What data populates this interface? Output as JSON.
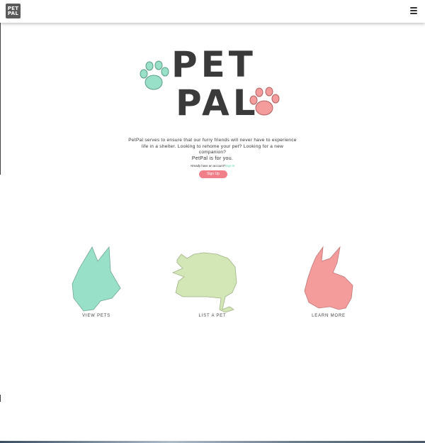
{
  "navbar": {
    "logo_line1": "PET",
    "logo_line2": "PAL",
    "menu_icon": "hamburger-menu-icon"
  },
  "hero": {
    "logo_word1": "PET",
    "logo_word2": "PAL",
    "description": "PetPal serves to ensure that our furry friends will never have to experience life in a shelter. Looking to rehome your pet? Looking for a new companion?",
    "tagline": "PetPal is for you.",
    "account_prompt": "Already have an account?",
    "signin_link": "Sign in",
    "signup_label": "Sign Up"
  },
  "cards": [
    {
      "label": "VIEW PETS",
      "icon": "dog-silhouette-icon",
      "color": "#99e0c8"
    },
    {
      "label": "LIST A PET",
      "icon": "cat-silhouette-icon",
      "color": "#d3e6b6"
    },
    {
      "label": "LEARN MORE",
      "icon": "rabbit-silhouette-icon",
      "color": "#f49b9b"
    }
  ],
  "colors": {
    "mint": "#99e0c8",
    "pink": "#f49b9b",
    "button": "#f07f8a",
    "link": "#5fcfae",
    "text": "#3a3a3a"
  }
}
